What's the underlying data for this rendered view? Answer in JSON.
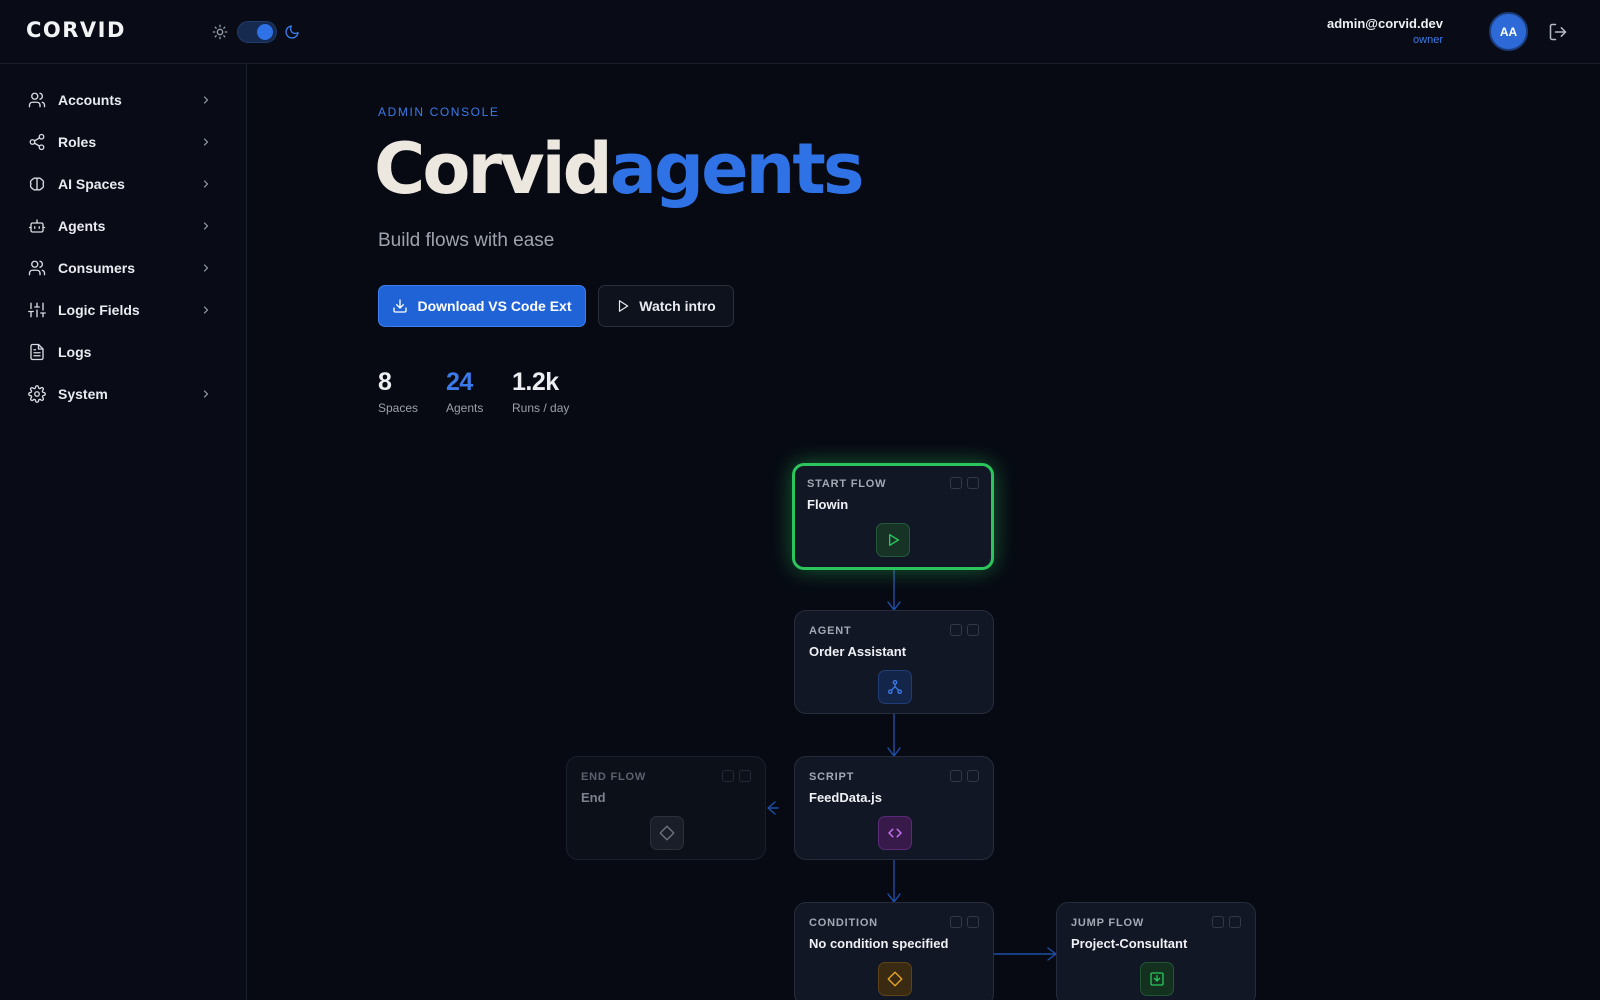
{
  "app": {
    "logo": "CORVID"
  },
  "header": {
    "user_email": "admin@corvid.dev",
    "user_role": "owner",
    "avatar_initials": "AA"
  },
  "sidebar": {
    "items": [
      {
        "label": "Accounts",
        "icon": "users-icon",
        "has_submenu": true
      },
      {
        "label": "Roles",
        "icon": "share-icon",
        "has_submenu": true
      },
      {
        "label": "AI Spaces",
        "icon": "brain-icon",
        "has_submenu": true
      },
      {
        "label": "Agents",
        "icon": "bot-icon",
        "has_submenu": true
      },
      {
        "label": "Consumers",
        "icon": "users-icon",
        "has_submenu": true
      },
      {
        "label": "Logic Fields",
        "icon": "sliders-icon",
        "has_submenu": true
      },
      {
        "label": "Logs",
        "icon": "file-text-icon",
        "has_submenu": false
      },
      {
        "label": "System",
        "icon": "gear-icon",
        "has_submenu": true
      }
    ]
  },
  "main": {
    "eyebrow": "ADMIN CONSOLE",
    "hero_part1": "Corvid",
    "hero_part2": "agents",
    "subtitle": "Build flows with ease",
    "primary_button": "Download VS Code Ext",
    "secondary_button": "Watch intro",
    "stats": [
      {
        "value": "8",
        "label": "Spaces"
      },
      {
        "value": "24",
        "label": "Agents"
      },
      {
        "value": "1.2k",
        "label": "Runs / day"
      }
    ]
  },
  "flow": {
    "nodes": [
      {
        "type": "START FLOW",
        "title": "Flowin",
        "icon": "play-icon"
      },
      {
        "type": "AGENT",
        "title": "Order Assistant",
        "icon": "network-icon"
      },
      {
        "type": "SCRIPT",
        "title": "FeedData.js",
        "icon": "code-icon"
      },
      {
        "type": "END FLOW",
        "title": "End",
        "icon": "diamond-icon"
      },
      {
        "type": "CONDITION",
        "title": "No condition specified",
        "icon": "diamond-icon"
      },
      {
        "type": "JUMP FLOW",
        "title": "Project-Consultant",
        "icon": "jump-icon"
      }
    ]
  },
  "colors": {
    "accent": "#2f72e6",
    "start_border": "#2bc55c",
    "background": "#070a13"
  }
}
